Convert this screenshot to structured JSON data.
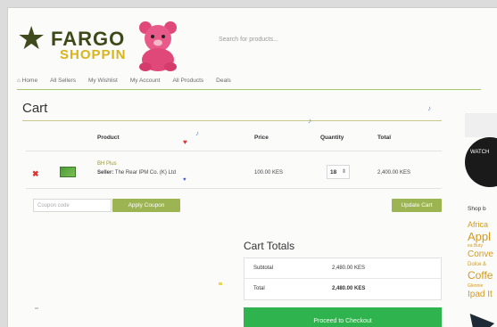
{
  "header": {
    "logo_line1": "FARGO",
    "logo_line2": "SHOPPIN",
    "search_placeholder": "Search for products..."
  },
  "nav": [
    {
      "label": "⌂ Home"
    },
    {
      "label": "All Sellers"
    },
    {
      "label": "My Wishlist"
    },
    {
      "label": "My Account"
    },
    {
      "label": "All Products"
    },
    {
      "label": "Deals"
    }
  ],
  "cart": {
    "title": "Cart",
    "columns": {
      "product": "Product",
      "price": "Price",
      "quantity": "Quantity",
      "total": "Total"
    },
    "item": {
      "name": "BH Plus",
      "seller_label": "Seller:",
      "seller_name": "The Rear IPM Co. (K) Ltd",
      "price": "100.00 KES",
      "quantity": "18",
      "total": "2,400.00 KES"
    },
    "coupon_placeholder": "Coupon code",
    "apply_coupon": "Apply Coupon",
    "update_cart": "Update Cart"
  },
  "totals": {
    "title": "Cart Totals",
    "subtotal_label": "Subtotal",
    "subtotal_value": "2,480.00 KES",
    "total_label": "Total",
    "total_value": "2,480.00 KES",
    "checkout": "Proceed to Checkout"
  },
  "sidebar": {
    "watch_text": "WATCH",
    "shop_label": "Shop b",
    "brands": [
      "Africa",
      "Appl",
      "ea Buty",
      "Conve",
      "Dolce &",
      "Coffe",
      "Glennie",
      "Ipad It"
    ]
  },
  "colors": {
    "accent_olive": "#9cb552",
    "checkout_green": "#2fb34f",
    "brand_orange": "#d39a1e"
  }
}
